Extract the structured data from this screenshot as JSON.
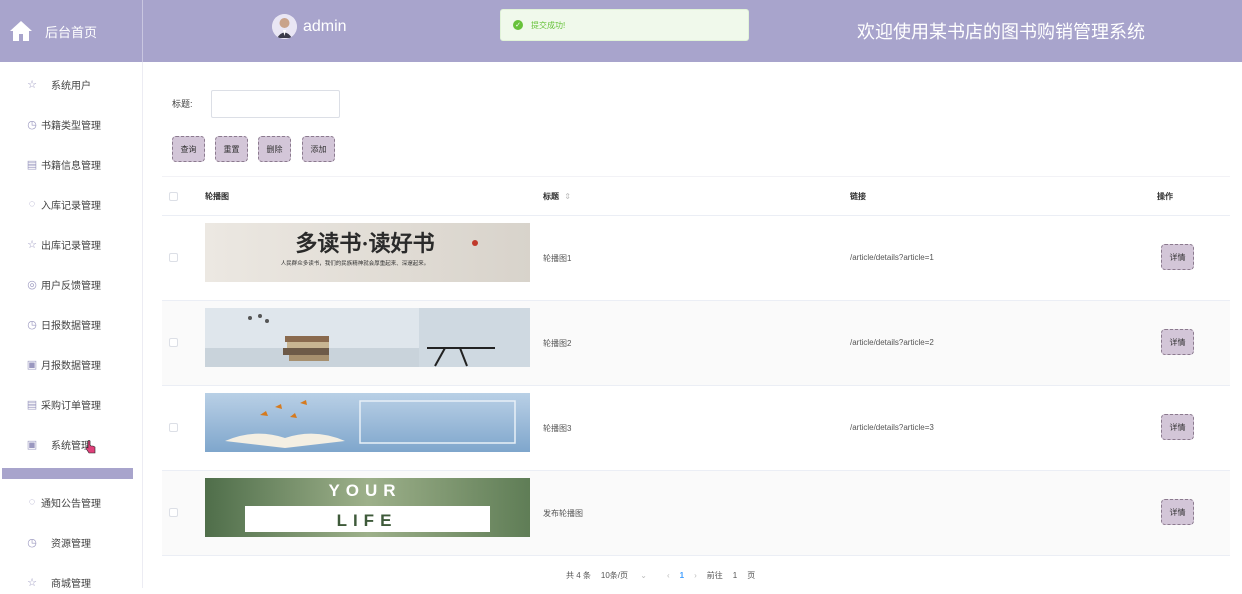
{
  "header": {
    "home_label": "后台首页",
    "user_name": "admin",
    "toast": "提交成功!",
    "system_title": "欢迎使用某书店的图书购销管理系统"
  },
  "sidebar": {
    "items": [
      {
        "label": "系统用户",
        "icon": "star-icon"
      },
      {
        "label": "书籍类型管理",
        "icon": "clock-icon"
      },
      {
        "label": "书籍信息管理",
        "icon": "box-icon"
      },
      {
        "label": "入库记录管理",
        "icon": "arc-icon"
      },
      {
        "label": "出库记录管理",
        "icon": "star-icon"
      },
      {
        "label": "用户反馈管理",
        "icon": "compass-icon"
      },
      {
        "label": "日报数据管理",
        "icon": "clock-icon"
      },
      {
        "label": "月报数据管理",
        "icon": "calendar-icon"
      },
      {
        "label": "采购订单管理",
        "icon": "box-icon"
      },
      {
        "label": "系统管理",
        "icon": "calendar-icon"
      },
      {
        "label": "通知公告管理",
        "icon": "arc-icon"
      },
      {
        "label": "资源管理",
        "icon": "clock-icon"
      },
      {
        "label": "商城管理",
        "icon": "star-icon"
      }
    ]
  },
  "search": {
    "label": "标题:",
    "value": ""
  },
  "toolbar": {
    "query": "查询",
    "reset": "重置",
    "delete": "删除",
    "add": "添加"
  },
  "table": {
    "columns": {
      "image": "轮播图",
      "title": "标题",
      "link": "链接",
      "action": "操作"
    },
    "rows": [
      {
        "title": "轮播图1",
        "link": "/article/details?article=1",
        "action": "详情",
        "image_text": "多读书·读好书",
        "image_sub": "人民群众多读书，我们的民族精神就会厚重起来、深邃起来。"
      },
      {
        "title": "轮播图2",
        "link": "/article/details?article=2",
        "action": "详情"
      },
      {
        "title": "轮播图3",
        "link": "/article/details?article=3",
        "action": "详情"
      },
      {
        "title": "发布轮播图",
        "link": "",
        "action": "详情",
        "image_text": "YOUR",
        "image_text2": "LIFE"
      }
    ]
  },
  "pagination": {
    "total": "共 4 条",
    "page_size": "10条/页",
    "current": "1",
    "goto": "前往",
    "goto_value": "1",
    "page_unit": "页"
  },
  "colors": {
    "header_bg": "#a8a4cc",
    "button_bg": "#d3c6d8",
    "toast_text": "#67c23a"
  }
}
